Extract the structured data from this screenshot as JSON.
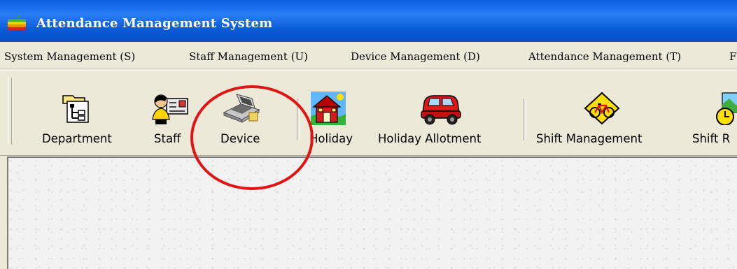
{
  "window": {
    "title": "Attendance Management System",
    "icon": "apple-logo-icon"
  },
  "menu": [
    {
      "label": "System Management (S)"
    },
    {
      "label": "Staff Management (U)"
    },
    {
      "label": "Device Management (D)"
    },
    {
      "label": "Attendance Management (T)"
    },
    {
      "label": "F"
    }
  ],
  "toolbar": [
    {
      "label": "Department",
      "icon": "department-icon"
    },
    {
      "label": "Staff",
      "icon": "staff-icon"
    },
    {
      "label": "Device",
      "icon": "device-icon"
    },
    {
      "label": "Holiday",
      "icon": "holiday-icon"
    },
    {
      "label": "Holiday Allotment",
      "icon": "holiday-allotment-icon"
    },
    {
      "label": "Shift Management",
      "icon": "shift-management-icon"
    },
    {
      "label": "Shift R",
      "icon": "shift-r-icon"
    }
  ],
  "colors": {
    "titlebar": "#0a5fe0",
    "highlight": "#e11414",
    "chrome": "#ece9d8"
  }
}
